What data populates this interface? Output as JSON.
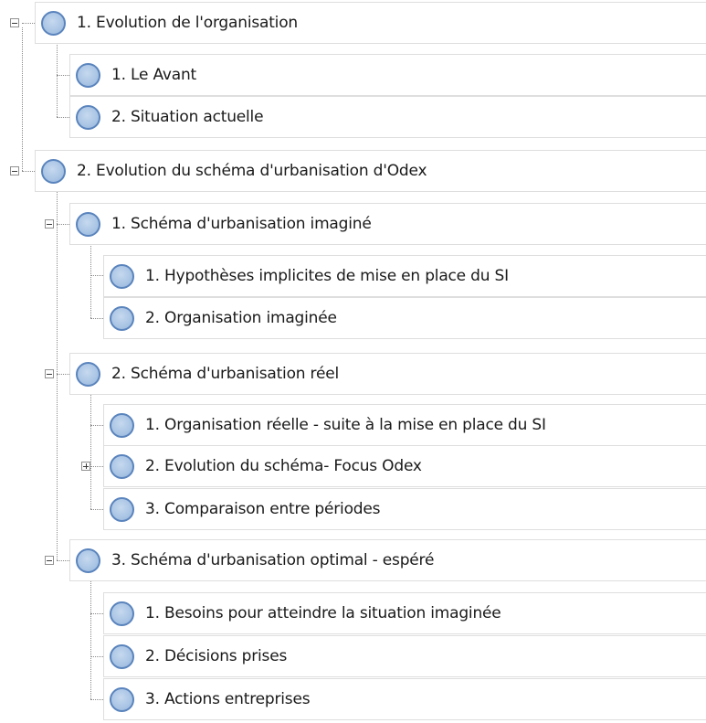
{
  "tree": {
    "nodes": [
      {
        "label": "1. Evolution de l'organisation",
        "expander": "expanded"
      },
      {
        "label": "1. Le Avant",
        "expander": "none"
      },
      {
        "label": "2. Situation actuelle",
        "expander": "none"
      },
      {
        "label": "2. Evolution du schéma d'urbanisation d'Odex",
        "expander": "expanded"
      },
      {
        "label": "1. Schéma d'urbanisation imaginé",
        "expander": "expanded"
      },
      {
        "label": "1. Hypothèses implicites de mise en place du SI",
        "expander": "none"
      },
      {
        "label": "2. Organisation imaginée",
        "expander": "none"
      },
      {
        "label": "2. Schéma d'urbanisation réel",
        "expander": "expanded"
      },
      {
        "label": "1. Organisation réelle -  suite à la mise en place du SI",
        "expander": "none"
      },
      {
        "label": "2. Evolution du schéma- Focus Odex",
        "expander": "collapsed"
      },
      {
        "label": "3. Comparaison entre périodes",
        "expander": "none"
      },
      {
        "label": "3. Schéma d'urbanisation optimal - espéré",
        "expander": "expanded"
      },
      {
        "label": "1. Besoins pour atteindre la situation imaginée",
        "expander": "none"
      },
      {
        "label": "2. Décisions prises",
        "expander": "none"
      },
      {
        "label": "3. Actions entreprises",
        "expander": "none"
      }
    ]
  },
  "colors": {
    "node_fill": "#a9c4e4",
    "node_border": "#5a84bd",
    "row_border": "#dedede",
    "connector": "#8a8a8a"
  },
  "icons": {
    "node": "circle-node-icon",
    "expand": "plus-box-icon",
    "collapse": "minus-box-icon"
  }
}
